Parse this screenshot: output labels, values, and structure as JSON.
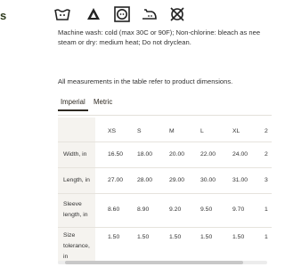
{
  "section_fragment": "s",
  "care": {
    "icons": [
      "wash-30-icon",
      "no-bleach-icon",
      "tumble-dry-medium-icon",
      "iron-medium-icon",
      "do-not-dryclean-icon"
    ],
    "lines": [
      "Machine wash: cold (max 30C or 90F); Non-chlorine: bleach as nee",
      "steam or dry: medium heat; Do not dryclean."
    ]
  },
  "measure_note": "All measurements in the table refer to product dimensions.",
  "tabs": [
    {
      "label": "Imperial",
      "active": true
    },
    {
      "label": "Metric",
      "active": false
    }
  ],
  "table": {
    "sizes": [
      "XS",
      "S",
      "M",
      "L",
      "XL",
      "2"
    ],
    "rows": [
      {
        "label": "Width, in",
        "values": [
          "16.50",
          "18.00",
          "20.00",
          "22.00",
          "24.00",
          "2"
        ]
      },
      {
        "label": "Length, in",
        "values": [
          "27.00",
          "28.00",
          "29.00",
          "30.00",
          "31.00",
          "3"
        ]
      },
      {
        "label": "Sleeve length, in",
        "values": [
          "8.60",
          "8.90",
          "9.20",
          "9.50",
          "9.70",
          "1"
        ]
      },
      {
        "label": "Size tolerance, in",
        "values": [
          "1.50",
          "1.50",
          "1.50",
          "1.50",
          "1.50",
          "1"
        ]
      }
    ]
  }
}
